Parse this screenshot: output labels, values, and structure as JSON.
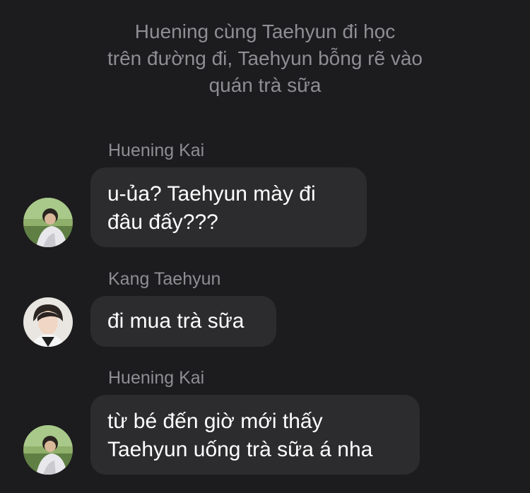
{
  "system_note": {
    "lines": [
      "Huening cùng Taehyun đi học",
      "trên đường đi, Taehyun bỗng rẽ vào",
      "quán trà sữa"
    ]
  },
  "messages": [
    {
      "sender": "Huening Kai",
      "avatar": "huening-avatar",
      "lines": [
        "u-ủa? Taehyun mày đi",
        "đâu đấy???"
      ]
    },
    {
      "sender": "Kang Taehyun",
      "avatar": "taehyun-avatar",
      "lines": [
        "đi mua trà sữa"
      ]
    },
    {
      "sender": "Huening Kai",
      "avatar": "huening-avatar",
      "lines": [
        "từ bé đến giờ mới thấy",
        "Taehyun uống trà sữa á nha"
      ]
    }
  ]
}
